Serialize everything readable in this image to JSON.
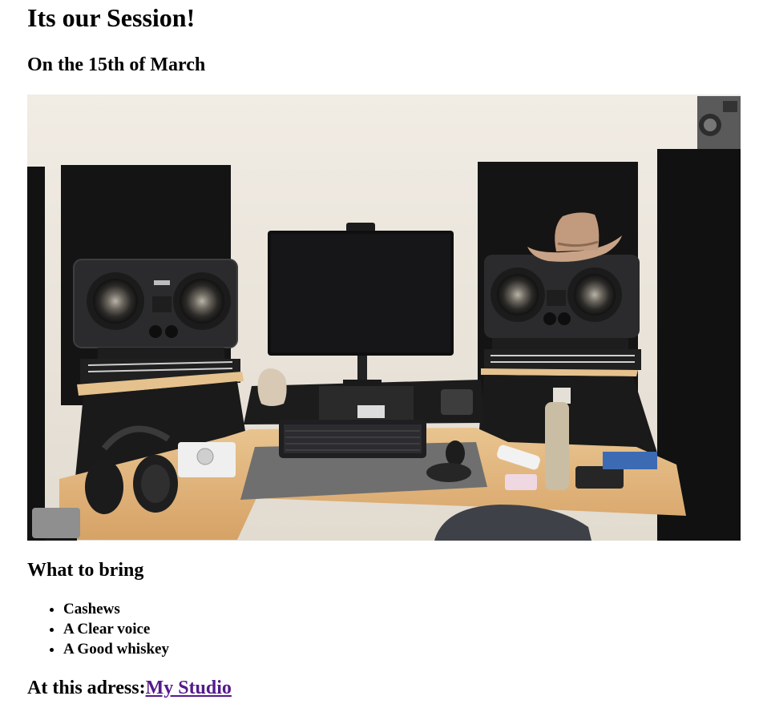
{
  "page": {
    "title": "Its our Session!",
    "date": "On the 15th of March"
  },
  "photo": {
    "alt": "Recording studio desk with monitor speakers, computer screen, keyboard and headphones",
    "colors": {
      "wall": "#ece7df",
      "desk_wood": "#e1b57e",
      "panel": "#151515",
      "speaker": "#2a2a2c",
      "felt": "#6f6f6f"
    }
  },
  "bring": {
    "heading": "What to bring",
    "items": [
      "Cashews",
      "A Clear voice",
      "A Good whiskey"
    ]
  },
  "address": {
    "label": "At this adress:",
    "link_text": "My Studio",
    "link_color": "#551a8b"
  }
}
